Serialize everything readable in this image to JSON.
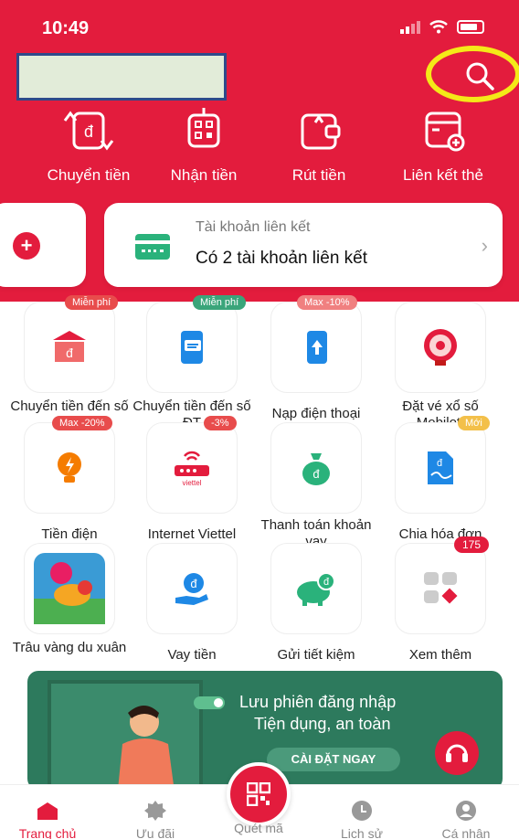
{
  "status_bar": {
    "time": "10:49"
  },
  "quick_actions": [
    {
      "label": "Chuyển tiền",
      "icon": "transfer-icon"
    },
    {
      "label": "Nhận tiền",
      "icon": "qr-receive-icon"
    },
    {
      "label": "Rút tiền",
      "icon": "withdraw-icon"
    },
    {
      "label": "Liên kết thẻ",
      "icon": "link-card-icon"
    }
  ],
  "linked_account": {
    "subtitle": "Tài khoản liên kết",
    "title": "Có 2 tài khoản liên kết"
  },
  "services": [
    {
      "label": "Chuyển tiền đến số TK",
      "badge": "Miễn phí"
    },
    {
      "label": "Chuyển tiền đến số ĐT",
      "badge": "Miễn phí"
    },
    {
      "label": "Nạp điện thoại",
      "badge": "Max -10%"
    },
    {
      "label": "Đặt vé xổ số Mobilott",
      "badge": ""
    },
    {
      "label": "Tiền điện",
      "badge": "Max -20%"
    },
    {
      "label": "Internet Viettel",
      "badge": "-3%"
    },
    {
      "label": "Thanh toán khoản vay",
      "badge": ""
    },
    {
      "label": "Chia hóa đơn",
      "badge": "Mới"
    },
    {
      "label": "Trâu vàng du xuân",
      "badge": ""
    },
    {
      "label": "Vay tiền",
      "badge": ""
    },
    {
      "label": "Gửi tiết kiệm",
      "badge": ""
    },
    {
      "label": "Xem thêm",
      "badge": "175"
    }
  ],
  "viettel_text": "viettel",
  "banner": {
    "line1": "Lưu phiên đăng nhập",
    "line2": "Tiện dụng, an toàn",
    "cta": "CÀI ĐẶT NGAY"
  },
  "nav": {
    "home": "Trang chủ",
    "offers": "Ưu đãi",
    "scan": "Quét mã",
    "history": "Lịch sử",
    "profile": "Cá nhân"
  },
  "colors": {
    "primary": "#e31c3d",
    "banner": "#2d7a5d"
  }
}
